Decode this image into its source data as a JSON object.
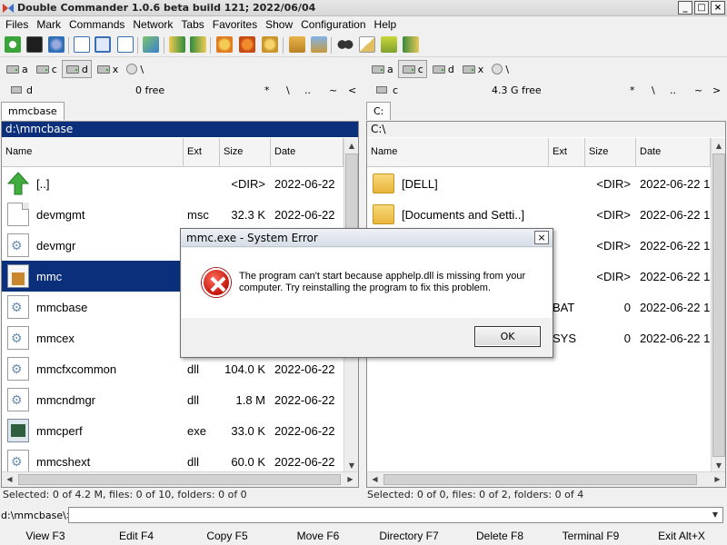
{
  "window": {
    "title": "Double Commander 1.0.6 beta build 121; 2022/06/04",
    "controls": [
      "_",
      "□",
      "×"
    ]
  },
  "menu": [
    "Files",
    "Mark",
    "Commands",
    "Network",
    "Tabs",
    "Favorites",
    "Show",
    "Configuration",
    "Help"
  ],
  "left": {
    "drives": [
      {
        "label": "a",
        "active": false
      },
      {
        "label": "c",
        "active": false
      },
      {
        "label": "d",
        "active": true
      },
      {
        "label": "x",
        "active": false
      },
      {
        "label": "\\",
        "active": false
      }
    ],
    "drive": "d",
    "free": "0 free",
    "nav": [
      "*",
      "\\",
      "..",
      "~",
      "<"
    ],
    "tab": "mmcbase",
    "path": "d:\\mmcbase",
    "columns": [
      "Name",
      "Ext",
      "Size",
      "Date"
    ],
    "files": [
      {
        "name": "[..]",
        "ext": "",
        "size": "<DIR>",
        "date": "2022-06-22",
        "icon": "up-arrow-icon"
      },
      {
        "name": "devmgmt",
        "ext": "msc",
        "size": "32.3 K",
        "date": "2022-06-22",
        "icon": "document-icon"
      },
      {
        "name": "devmgr",
        "ext": "",
        "size": "",
        "date": "",
        "icon": "settings-file-icon"
      },
      {
        "name": "mmc",
        "ext": "",
        "size": "",
        "date": "",
        "icon": "mmc-icon",
        "selected": true
      },
      {
        "name": "mmcbase",
        "ext": "",
        "size": "",
        "date": "",
        "icon": "settings-file-icon"
      },
      {
        "name": "mmcex",
        "ext": "",
        "size": "",
        "date": "",
        "icon": "settings-file-icon"
      },
      {
        "name": "mmcfxcommon",
        "ext": "dll",
        "size": "104.0 K",
        "date": "2022-06-22",
        "icon": "settings-file-icon"
      },
      {
        "name": "mmcndmgr",
        "ext": "dll",
        "size": "1.8 M",
        "date": "2022-06-22",
        "icon": "settings-file-icon"
      },
      {
        "name": "mmcperf",
        "ext": "exe",
        "size": "33.0 K",
        "date": "2022-06-22",
        "icon": "exe-icon"
      },
      {
        "name": "mmcshext",
        "ext": "dll",
        "size": "60.0 K",
        "date": "2022-06-22",
        "icon": "settings-file-icon"
      }
    ],
    "status": "Selected: 0 of 4.2 M, files: 0 of 10, folders: 0 of 0"
  },
  "right": {
    "drives": [
      {
        "label": "a",
        "active": false
      },
      {
        "label": "c",
        "active": true
      },
      {
        "label": "d",
        "active": false
      },
      {
        "label": "x",
        "active": false
      },
      {
        "label": "\\",
        "active": false
      }
    ],
    "drive": "c",
    "free": "4.3 G free",
    "nav": [
      "*",
      "\\",
      "..",
      "~",
      ">"
    ],
    "tab": "C:",
    "path": "C:\\",
    "columns": [
      "Name",
      "Ext",
      "Size",
      "Date"
    ],
    "files": [
      {
        "name": "[DELL]",
        "ext": "",
        "size": "<DIR>",
        "date": "2022-06-22 1",
        "icon": "folder-icon"
      },
      {
        "name": "[Documents and Setti..]",
        "ext": "",
        "size": "<DIR>",
        "date": "2022-06-22 1",
        "icon": "folder-icon"
      },
      {
        "name": "",
        "ext": "",
        "size": "<DIR>",
        "date": "2022-06-22 1",
        "icon": "folder-icon"
      },
      {
        "name": "",
        "ext": "",
        "size": "<DIR>",
        "date": "2022-06-22 1",
        "icon": "folder-icon"
      },
      {
        "name": "",
        "ext": "BAT",
        "size": "0",
        "date": "2022-06-22 1",
        "icon": ""
      },
      {
        "name": "",
        "ext": "SYS",
        "size": "0",
        "date": "2022-06-22 1",
        "icon": ""
      }
    ],
    "status": "Selected: 0 of 0, files: 0 of 2, folders: 0 of 4"
  },
  "cmdline": {
    "label": "d:\\mmcbase\\>",
    "value": ""
  },
  "fkeys": [
    "View F3",
    "Edit F4",
    "Copy F5",
    "Move F6",
    "Directory F7",
    "Delete F8",
    "Terminal F9",
    "Exit Alt+X"
  ],
  "dialog": {
    "title": "mmc.exe - System Error",
    "close": "×",
    "message": "The program can't start because apphelp.dll is missing from your computer. Try reinstalling the program to fix this problem.",
    "ok": "OK",
    "icon": "error-icon"
  },
  "toolbar_icons": [
    "refresh-icon",
    "terminal-icon",
    "options-icon",
    "brief-view-icon",
    "full-view-icon",
    "thumbnail-view-icon",
    "compare-icon",
    "copy-path-left-icon",
    "copy-path-right-icon",
    "multi-rename-icon",
    "plugin-icon",
    "pack-icon",
    "unpack-icon",
    "search-icon",
    "edit-icon",
    "sync-dirs-icon",
    "copy-names-icon"
  ],
  "colors": {
    "selection": "#0b2f7a",
    "active_path": "#0b2f7a"
  }
}
